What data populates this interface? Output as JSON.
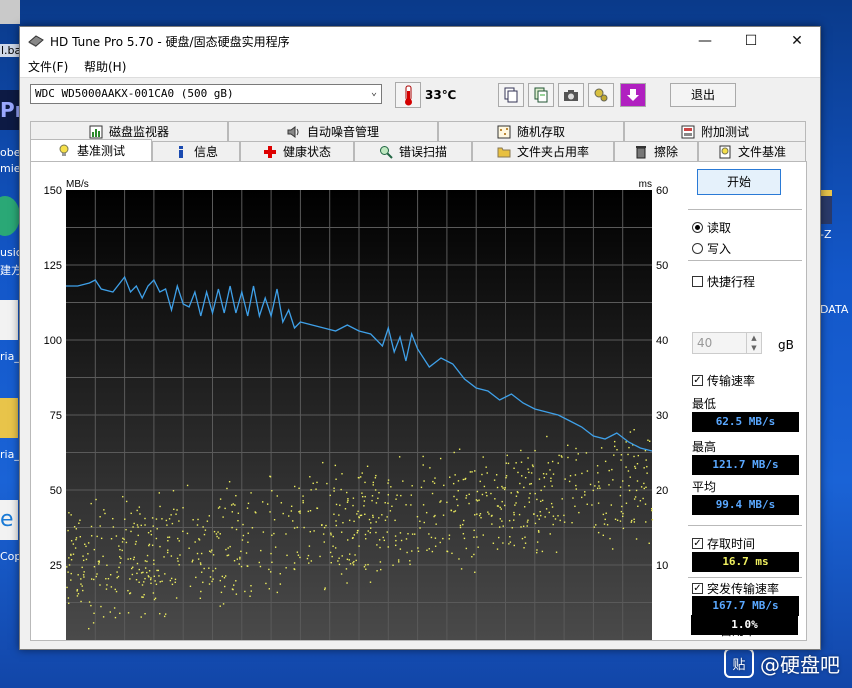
{
  "desktop": {
    "icon_fragments": [
      "l.ba",
      "Pr",
      "obe",
      "mie",
      "usic",
      "建方",
      "ria_",
      "ria_",
      "Cop"
    ],
    "right_fragments": [
      "-Z",
      "DATA"
    ]
  },
  "watermark": {
    "badge": "贴",
    "text": "@硬盘吧"
  },
  "window": {
    "title": "HD Tune Pro 5.70 - 硬盘/固态硬盘实用程序",
    "controls": {
      "minimize": "—",
      "maximize": "☐",
      "close": "✕"
    }
  },
  "menu": {
    "items": [
      "文件(F)",
      "帮助(H)"
    ]
  },
  "toolbar": {
    "drive": "WDC WD5000AAKX-001CA0 (500 gB)",
    "temperature": "33℃",
    "exit_label": "退出"
  },
  "tabs": {
    "row1": [
      "磁盘监视器",
      "自动噪音管理",
      "随机存取",
      "附加测试"
    ],
    "row2": [
      "基准测试",
      "信息",
      "健康状态",
      "错误扫描",
      "文件夹占用率",
      "擦除",
      "文件基准"
    ],
    "active": "基准测试"
  },
  "panel": {
    "start_label": "开始",
    "read_label": "读取",
    "write_label": "写入",
    "mode_selected": "读取",
    "short_stroke_label": "快捷行程",
    "short_stroke_checked": false,
    "short_stroke_value": "40",
    "short_stroke_unit": "gB",
    "transfer_rate_label": "传输速率",
    "transfer_rate_checked": true,
    "min_label": "最低",
    "min_value": "62.5 MB/s",
    "max_label": "最高",
    "max_value": "121.7 MB/s",
    "avg_label": "平均",
    "avg_value": "99.4 MB/s",
    "access_time_label": "存取时间",
    "access_time_checked": true,
    "access_time_value": "16.7 ms",
    "burst_label": "突发传输速率",
    "burst_checked": true,
    "burst_value": "167.7 MB/s",
    "cpu_label": "CPU 占用率",
    "cpu_value": "1.0%",
    "colors": {
      "rate": "#5aa8ff",
      "access": "#f0f060",
      "cpu": "#ffffff"
    }
  },
  "chart_data": {
    "type": "line",
    "ylabel": "MB/s",
    "y2label": "ms",
    "ylim": [
      0,
      150
    ],
    "y2lim": [
      0,
      60
    ],
    "yticks": [
      25,
      50,
      75,
      100,
      125,
      150
    ],
    "y2ticks": [
      10,
      20,
      30,
      40,
      50,
      60
    ],
    "xlim": [
      0,
      100
    ],
    "grid": true,
    "series": [
      {
        "color": "#3fa0e8",
        "x": [
          0,
          2,
          4,
          5,
          6,
          8,
          10,
          11,
          12,
          13,
          14,
          15,
          16,
          17,
          18,
          19,
          20,
          21,
          22,
          23,
          24,
          25,
          26,
          27,
          28,
          29,
          30,
          31,
          32,
          33,
          34,
          35,
          36,
          37,
          38,
          39,
          40,
          42,
          44,
          46,
          48,
          50,
          52,
          54,
          55,
          56,
          57,
          58,
          59,
          60,
          62,
          64,
          66,
          68,
          70,
          72,
          74,
          76,
          78,
          80,
          82,
          84,
          86,
          88,
          90,
          92,
          94,
          96,
          98,
          100
        ],
        "values": [
          118,
          118,
          119,
          120,
          117,
          116,
          121,
          116,
          118,
          114,
          118,
          120,
          116,
          117,
          110,
          118,
          112,
          111,
          116,
          108,
          116,
          109,
          117,
          109,
          118,
          109,
          116,
          108,
          118,
          108,
          114,
          108,
          117,
          106,
          110,
          104,
          106,
          105,
          104,
          103,
          105,
          103,
          102,
          98,
          104,
          96,
          101,
          93,
          102,
          97,
          91,
          94,
          92,
          87,
          84,
          83,
          80,
          82,
          79,
          77,
          76,
          75,
          73,
          71,
          68,
          67,
          69,
          66,
          64,
          63
        ]
      }
    ],
    "scatter": {
      "color": "#f0f060",
      "note": "access time samples (ms), roughly 7-25 ms, trending upward across the disk"
    }
  }
}
